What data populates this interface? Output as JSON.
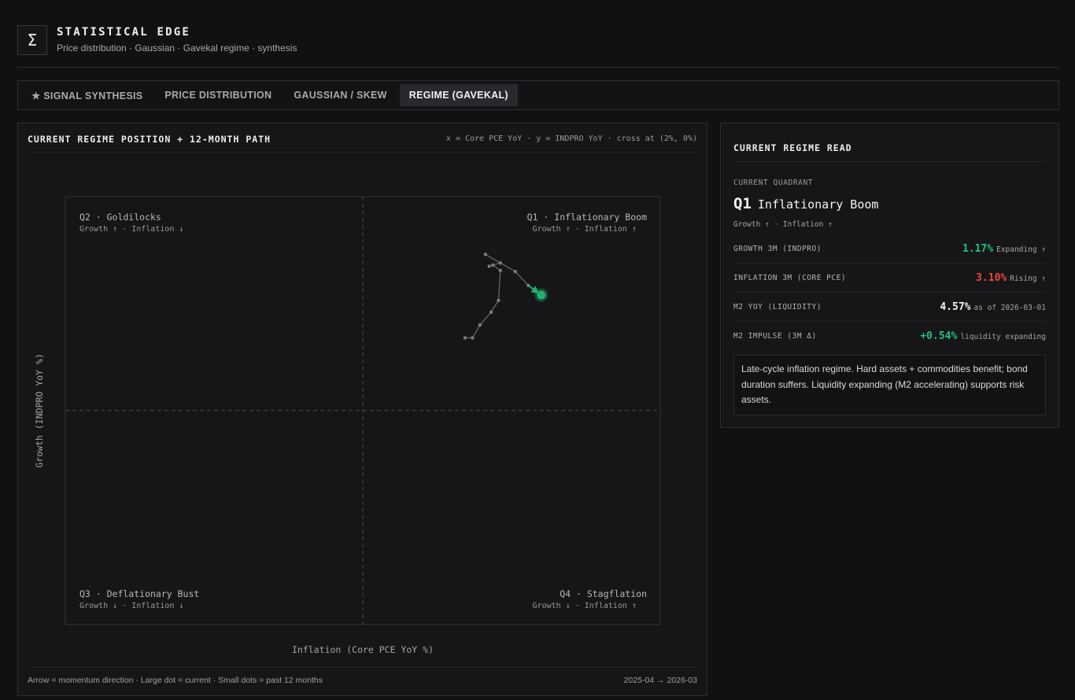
{
  "header": {
    "logo_glyph": "Σ",
    "title": "STATISTICAL EDGE",
    "subtitle": "Price distribution · Gaussian · Gavekal regime · synthesis"
  },
  "tabs": [
    {
      "label": "★ SIGNAL SYNTHESIS",
      "active": false
    },
    {
      "label": "PRICE DISTRIBUTION",
      "active": false
    },
    {
      "label": "GAUSSIAN / SKEW",
      "active": false
    },
    {
      "label": "REGIME (GAVEKAL)",
      "active": true
    }
  ],
  "regime_panel": {
    "title": "CURRENT REGIME POSITION + 12-MONTH PATH",
    "axis_note": "x = Core PCE YoY · y = INDPRO YoY · cross at (2%, 0%)",
    "footer_left": "Arrow = momentum direction · Large dot = current · Small dots = past 12 months",
    "footer_right": "2025-04 → 2026-03"
  },
  "chart_data": {
    "type": "scatter",
    "title": "",
    "xlabel": "Inflation (Core PCE YoY %)",
    "ylabel": "Growth (INDPRO YoY %)",
    "x_cross": 2,
    "y_cross": 0,
    "xlim": [
      0.4,
      3.6
    ],
    "ylim": [
      -2.0,
      2.0
    ],
    "grid": false,
    "quadrants": [
      {
        "id": "q2",
        "name": "Q2 · Goldilocks",
        "sub": "Growth ↑ · Inflation ↓",
        "position": "top-left"
      },
      {
        "id": "q1",
        "name": "Q1 · Inflationary Boom",
        "sub": "Growth ↑ · Inflation ↑",
        "position": "top-right"
      },
      {
        "id": "q3",
        "name": "Q3 · Deflationary Bust",
        "sub": "Growth ↓ · Inflation ↓",
        "position": "bottom-left"
      },
      {
        "id": "q4",
        "name": "Q4 · Stagflation",
        "sub": "Growth ↓ · Inflation ↑",
        "position": "bottom-right"
      }
    ],
    "path": [
      {
        "x": 2.55,
        "y": 0.68
      },
      {
        "x": 2.59,
        "y": 0.68
      },
      {
        "x": 2.63,
        "y": 0.8
      },
      {
        "x": 2.69,
        "y": 0.92
      },
      {
        "x": 2.73,
        "y": 1.03
      },
      {
        "x": 2.74,
        "y": 1.31
      },
      {
        "x": 2.7,
        "y": 1.36
      },
      {
        "x": 2.68,
        "y": 1.35
      },
      {
        "x": 2.74,
        "y": 1.38
      },
      {
        "x": 2.66,
        "y": 1.46
      },
      {
        "x": 2.82,
        "y": 1.3
      },
      {
        "x": 2.89,
        "y": 1.17
      }
    ],
    "current": {
      "x": 2.96,
      "y": 1.08
    },
    "colors": {
      "path": "#6b6b70",
      "current": "#1fb170",
      "divider": "#4a4a50"
    }
  },
  "read_panel": {
    "title": "CURRENT REGIME READ",
    "quadrant_label": "CURRENT QUADRANT",
    "quadrant_code": "Q1",
    "quadrant_name": "Inflationary Boom",
    "quadrant_sub": "Growth ↑ · Inflation ↑",
    "metrics": [
      {
        "label": "GROWTH 3M (INDPRO)",
        "value": "1.17%",
        "note": "Expanding ↑",
        "color": "#22c07a"
      },
      {
        "label": "INFLATION 3M (CORE PCE)",
        "value": "3.10%",
        "note": "Rising ↑",
        "color": "#ef4444"
      },
      {
        "label": "M2 YOY (LIQUIDITY)",
        "value": "4.57%",
        "note": "as of 2026-03-01",
        "color": "#f4f4f4"
      },
      {
        "label": "M2 IMPULSE (3M Δ)",
        "value": "+0.54%",
        "note": "liquidity expanding",
        "color": "#22c07a"
      }
    ],
    "summary": "Late-cycle inflation regime. Hard assets + commodities benefit; bond duration suffers. Liquidity expanding (M2 accelerating) supports risk assets."
  }
}
